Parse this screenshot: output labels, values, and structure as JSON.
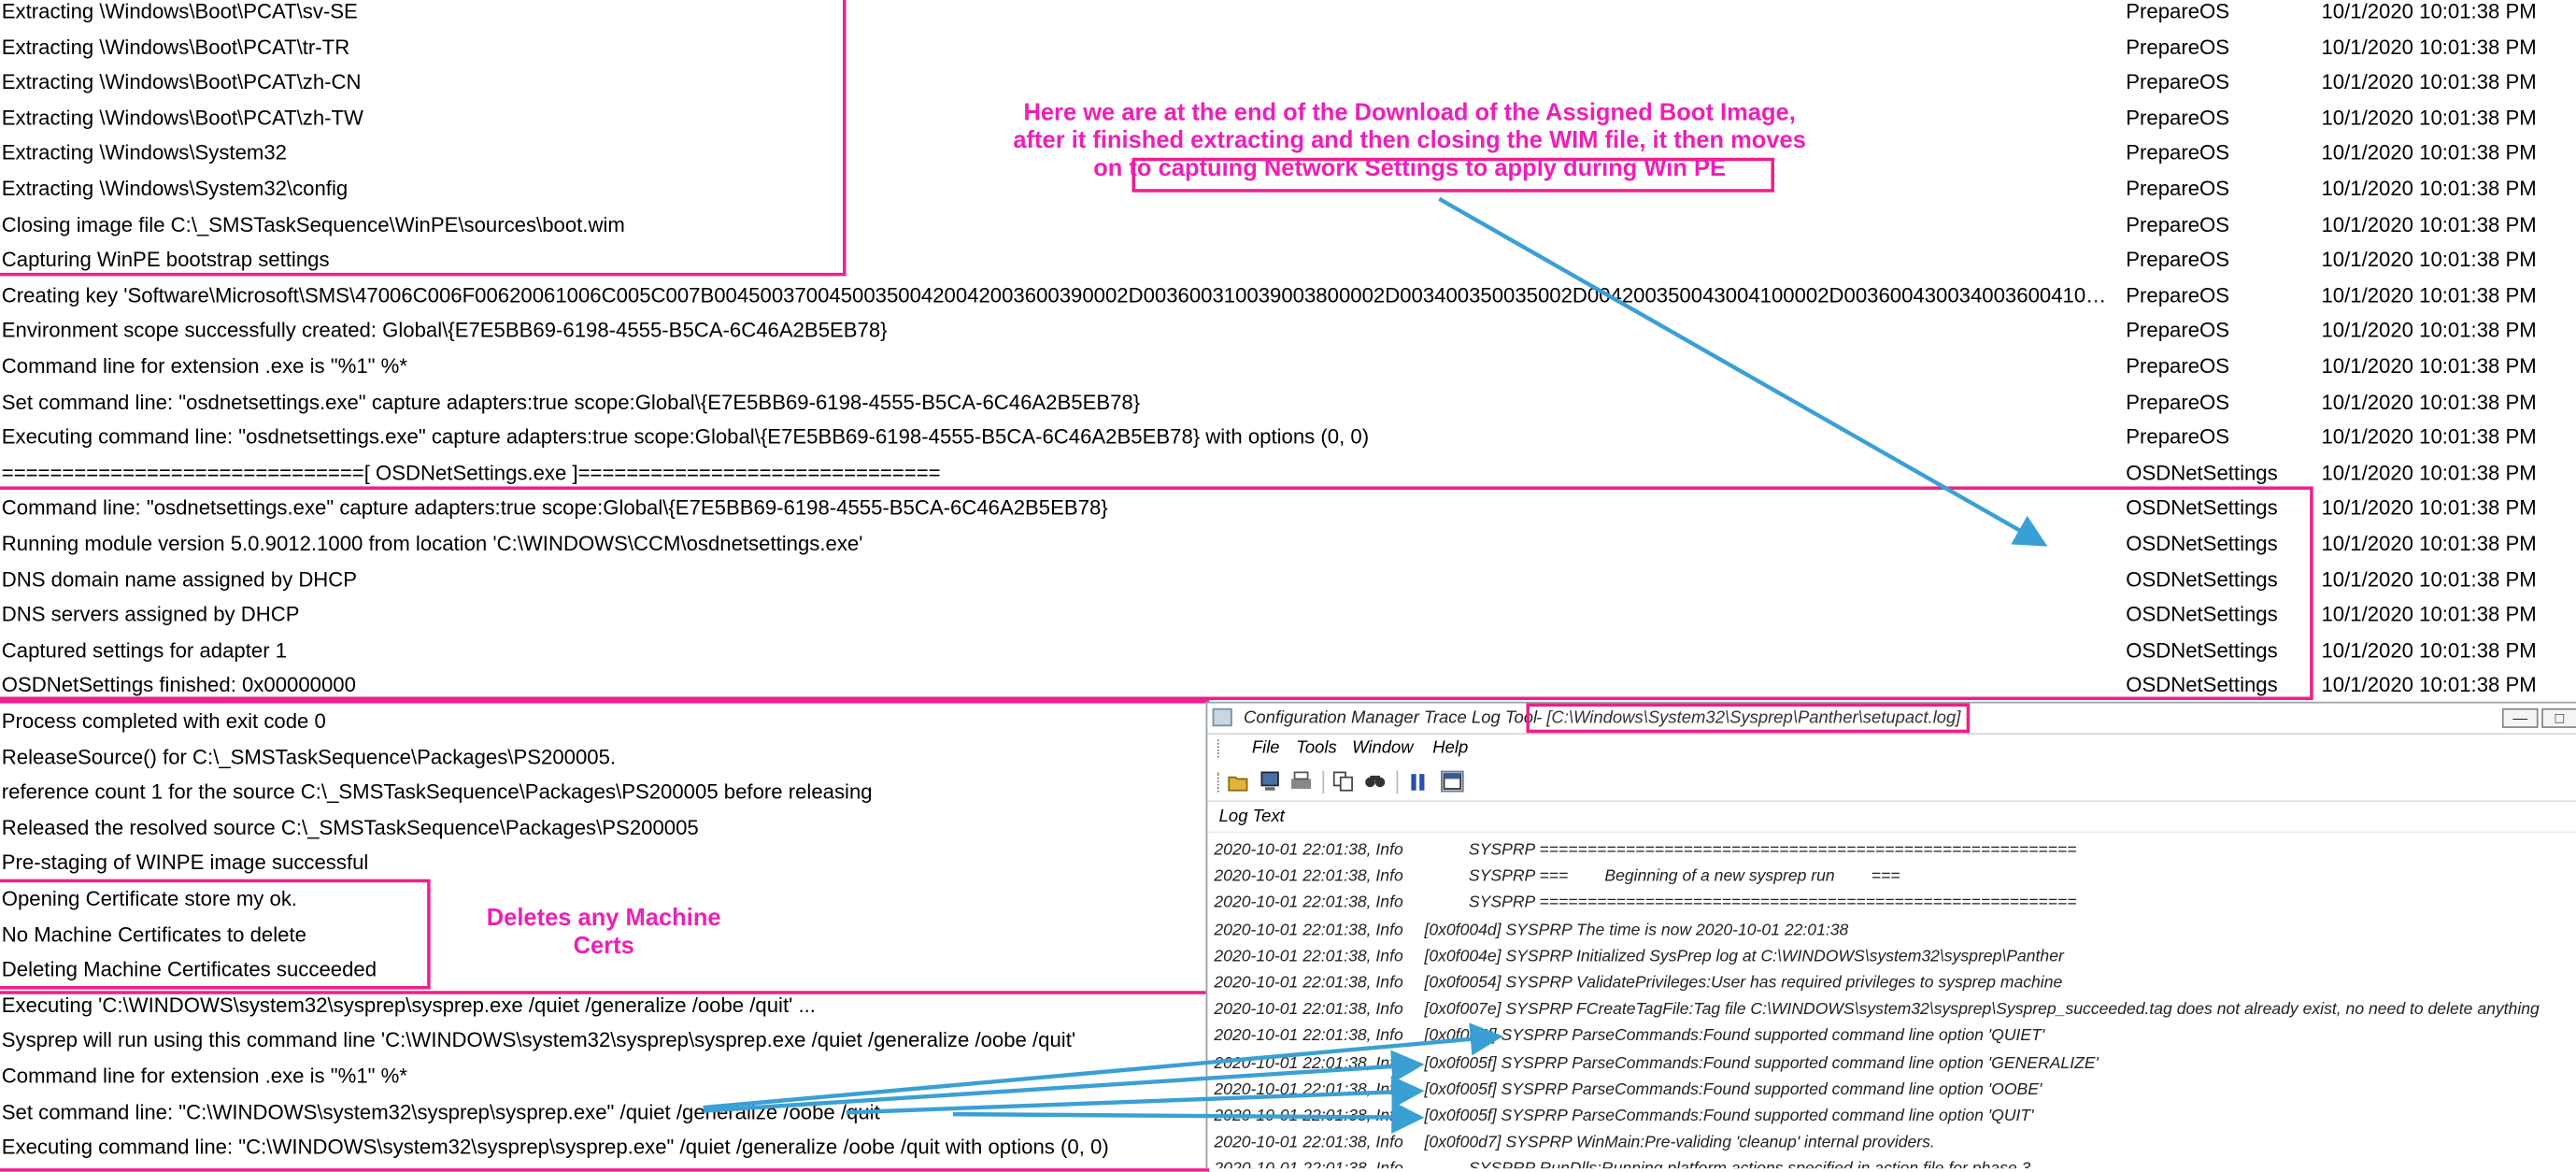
{
  "log_rows": [
    {
      "text": "Extracting \\Windows\\Boot\\PCAT\\sv-SE",
      "component": "PrepareOS",
      "time": "10/1/2020 10:01:38 PM"
    },
    {
      "text": "Extracting \\Windows\\Boot\\PCAT\\tr-TR",
      "component": "PrepareOS",
      "time": "10/1/2020 10:01:38 PM"
    },
    {
      "text": "Extracting \\Windows\\Boot\\PCAT\\zh-CN",
      "component": "PrepareOS",
      "time": "10/1/2020 10:01:38 PM"
    },
    {
      "text": "Extracting \\Windows\\Boot\\PCAT\\zh-TW",
      "component": "PrepareOS",
      "time": "10/1/2020 10:01:38 PM"
    },
    {
      "text": "Extracting \\Windows\\System32",
      "component": "PrepareOS",
      "time": "10/1/2020 10:01:38 PM"
    },
    {
      "text": "Extracting \\Windows\\System32\\config",
      "component": "PrepareOS",
      "time": "10/1/2020 10:01:38 PM"
    },
    {
      "text": "Closing image file C:\\_SMSTaskSequence\\WinPE\\sources\\boot.wim",
      "component": "PrepareOS",
      "time": "10/1/2020 10:01:38 PM"
    },
    {
      "text": "Capturing WinPE bootstrap settings",
      "component": "PrepareOS",
      "time": "10/1/2020 10:01:38 PM"
    },
    {
      "text": "Creating key 'Software\\Microsoft\\SMS\\47006C006F00620061006C005C007B004500370045003500420042003600390002D003600310039003800002D003400350035002D004200350043004100002D00360043003400360041003200...",
      "component": "PrepareOS",
      "time": "10/1/2020 10:01:38 PM"
    },
    {
      "text": "Environment scope successfully created: Global\\{E7E5BB69-6198-4555-B5CA-6C46A2B5EB78}",
      "component": "PrepareOS",
      "time": "10/1/2020 10:01:38 PM"
    },
    {
      "text": "Command line for extension .exe is \"%1\" %*",
      "component": "PrepareOS",
      "time": "10/1/2020 10:01:38 PM"
    },
    {
      "text": "Set command line: \"osdnetsettings.exe\" capture adapters:true scope:Global\\{E7E5BB69-6198-4555-B5CA-6C46A2B5EB78}",
      "component": "PrepareOS",
      "time": "10/1/2020 10:01:38 PM"
    },
    {
      "text": "Executing command line: \"osdnetsettings.exe\" capture adapters:true scope:Global\\{E7E5BB69-6198-4555-B5CA-6C46A2B5EB78} with options (0, 0)",
      "component": "PrepareOS",
      "time": "10/1/2020 10:01:38 PM"
    },
    {
      "text": "==============================[ OSDNetSettings.exe ]==============================",
      "component": "OSDNetSettings",
      "time": "10/1/2020 10:01:38 PM"
    },
    {
      "text": "Command line: \"osdnetsettings.exe\" capture adapters:true scope:Global\\{E7E5BB69-6198-4555-B5CA-6C46A2B5EB78}",
      "component": "OSDNetSettings",
      "time": "10/1/2020 10:01:38 PM"
    },
    {
      "text": "Running module version 5.0.9012.1000 from location 'C:\\WINDOWS\\CCM\\osdnetsettings.exe'",
      "component": "OSDNetSettings",
      "time": "10/1/2020 10:01:38 PM"
    },
    {
      "text": "DNS domain name assigned by DHCP",
      "component": "OSDNetSettings",
      "time": "10/1/2020 10:01:38 PM"
    },
    {
      "text": "DNS servers assigned by DHCP",
      "component": "OSDNetSettings",
      "time": "10/1/2020 10:01:38 PM"
    },
    {
      "text": "Captured settings for adapter 1",
      "component": "OSDNetSettings",
      "time": "10/1/2020 10:01:38 PM"
    },
    {
      "text": "OSDNetSettings finished: 0x00000000",
      "component": "OSDNetSettings",
      "time": "10/1/2020 10:01:38 PM"
    },
    {
      "text": "Process completed with exit code 0",
      "component": "",
      "time": ""
    },
    {
      "text": "ReleaseSource() for C:\\_SMSTaskSequence\\Packages\\PS200005.",
      "component": "",
      "time": ""
    },
    {
      "text": "reference count 1 for the source C:\\_SMSTaskSequence\\Packages\\PS200005 before releasing",
      "component": "",
      "time": ""
    },
    {
      "text": "Released the resolved source C:\\_SMSTaskSequence\\Packages\\PS200005",
      "component": "",
      "time": ""
    },
    {
      "text": "Pre-staging of WINPE image successful",
      "component": "",
      "time": ""
    },
    {
      "text": "Opening Certificate store my ok.",
      "component": "",
      "time": ""
    },
    {
      "text": "No Machine Certificates to delete",
      "component": "",
      "time": ""
    },
    {
      "text": "Deleting Machine Certificates succeeded",
      "component": "",
      "time": ""
    },
    {
      "text": "Executing 'C:\\WINDOWS\\system32\\sysprep\\sysprep.exe /quiet /generalize /oobe /quit' ...",
      "component": "",
      "time": ""
    },
    {
      "text": "Sysprep will run using this command line 'C:\\WINDOWS\\system32\\sysprep\\sysprep.exe /quiet /generalize /oobe /quit'",
      "component": "",
      "time": ""
    },
    {
      "text": "Command line for extension .exe is \"%1\" %*",
      "component": "",
      "time": ""
    },
    {
      "text": "Set command line: \"C:\\WINDOWS\\system32\\sysprep\\sysprep.exe\" /quiet /generalize /oobe /quit",
      "component": "",
      "time": ""
    },
    {
      "text": "Executing command line: \"C:\\WINDOWS\\system32\\sysprep\\sysprep.exe\" /quiet /generalize /oobe /quit with options (0, 0)",
      "component": "",
      "time": ""
    }
  ],
  "annotations": {
    "boot_image_note": [
      "Here we are at the end of the Download of the Assigned Boot Image,",
      "after it finished extracting and then closing the WIM file, it then moves",
      "on to captuing Network Settings to apply during Win PE"
    ],
    "certs_note": [
      "Deletes any Machine",
      "Certs"
    ]
  },
  "trace_window": {
    "title": "Configuration Manager Trace Log Tool",
    "path": "- [C:\\Windows\\System32\\Sysprep\\Panther\\setupact.log]",
    "menu": [
      "File",
      "Tools",
      "Window",
      "Help"
    ],
    "toolbar_icons": [
      "open-folder-icon",
      "computer-icon",
      "print-icon",
      "copy-icon",
      "find-icon",
      "pause-icon",
      "layout-icon"
    ],
    "column_header": "Log Text",
    "lines": [
      {
        "stamp": "2020-10-01 22:01:38, Info",
        "msg": "SYSPRP ========================================================"
      },
      {
        "stamp": "2020-10-01 22:01:38, Info",
        "msg": "SYSPRP ===        Beginning of a new sysprep run        ==="
      },
      {
        "stamp": "2020-10-01 22:01:38, Info",
        "msg": "SYSPRP ========================================================"
      },
      {
        "stamp": "2020-10-01 22:01:38, Info",
        "msg": "[0x0f004d] SYSPRP The time is now 2020-10-01 22:01:38"
      },
      {
        "stamp": "2020-10-01 22:01:38, Info",
        "msg": "[0x0f004e] SYSPRP Initialized SysPrep log at C:\\WINDOWS\\system32\\sysprep\\Panther"
      },
      {
        "stamp": "2020-10-01 22:01:38, Info",
        "msg": "[0x0f0054] SYSPRP ValidatePrivileges:User has required privileges to sysprep machine"
      },
      {
        "stamp": "2020-10-01 22:01:38, Info",
        "msg": "[0x0f007e] SYSPRP FCreateTagFile:Tag file C:\\WINDOWS\\system32\\sysprep\\Sysprep_succeeded.tag does not already exist, no need to delete anything"
      },
      {
        "stamp": "2020-10-01 22:01:38, Info",
        "msg": "[0x0f005f] SYSPRP ParseCommands:Found supported command line option 'QUIET'"
      },
      {
        "stamp": "2020-10-01 22:01:38, Info",
        "msg": "[0x0f005f] SYSPRP ParseCommands:Found supported command line option 'GENERALIZE'"
      },
      {
        "stamp": "2020-10-01 22:01:38, Info",
        "msg": "[0x0f005f] SYSPRP ParseCommands:Found supported command line option 'OOBE'"
      },
      {
        "stamp": "2020-10-01 22:01:38, Info",
        "msg": "[0x0f005f] SYSPRP ParseCommands:Found supported command line option 'QUIT'"
      },
      {
        "stamp": "2020-10-01 22:01:38, Info",
        "msg": "[0x0f00d7] SYSPRP WinMain:Pre-validing 'cleanup' internal providers."
      },
      {
        "stamp": "2020-10-01 22:01:38, Info",
        "msg": "SYSPRP RunDlls:Running platform actions specified in action file for phase 3"
      }
    ]
  },
  "colors": {
    "highlight": "#ee1f8c",
    "note_text": "#ee1fb8",
    "arrow": "#3aa0d4"
  }
}
